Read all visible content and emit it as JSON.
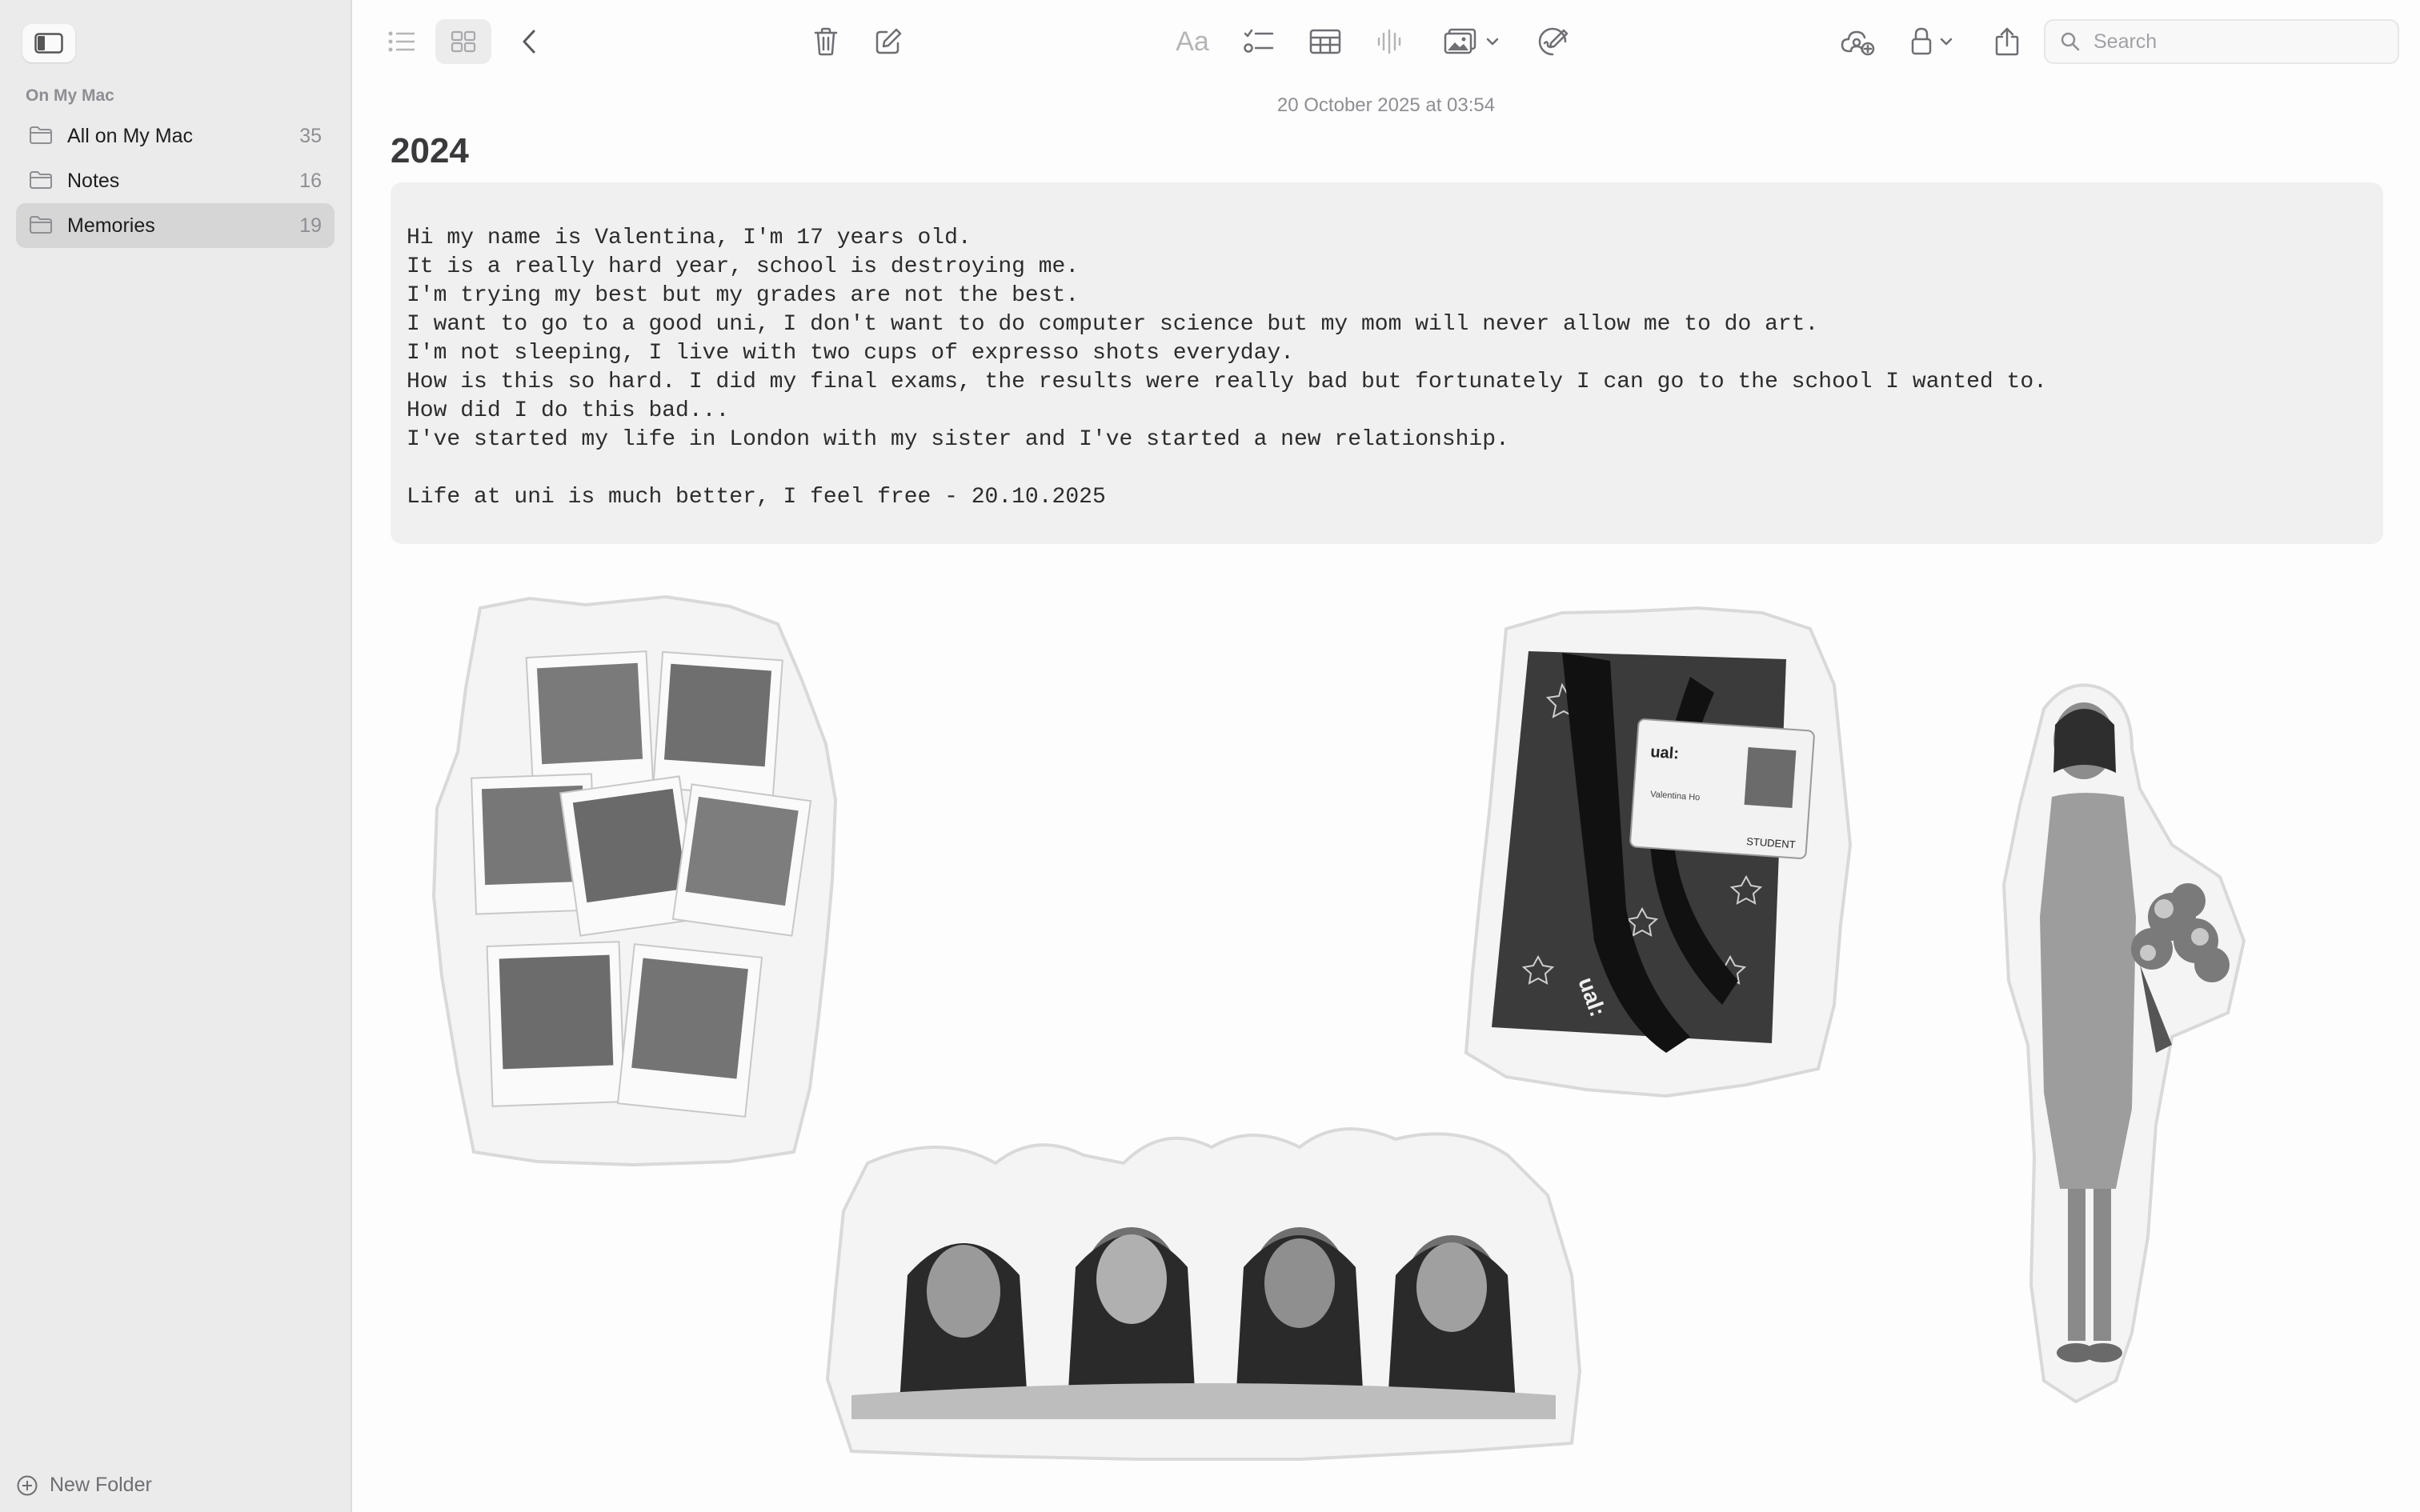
{
  "sidebar": {
    "section_title": "On My Mac",
    "folders": [
      {
        "label": "All on My Mac",
        "count": "35",
        "selected": false
      },
      {
        "label": "Notes",
        "count": "16",
        "selected": false
      },
      {
        "label": "Memories",
        "count": "19",
        "selected": true
      }
    ],
    "new_folder_label": "New Folder"
  },
  "toolbar": {
    "search_placeholder": "Search",
    "icons": [
      "sidebar-toggle-icon",
      "list-view-icon",
      "gallery-view-icon",
      "back-chevron-icon",
      "trash-icon",
      "compose-icon",
      "format-text-icon",
      "checklist-icon",
      "table-icon",
      "audio-waveform-icon",
      "media-icon",
      "markup-icon",
      "collaborate-icon",
      "lock-icon",
      "share-icon",
      "search-icon"
    ],
    "format_label": "Aa"
  },
  "note": {
    "date": "20 October 2025 at 03:54",
    "title": "2024",
    "code_lines": [
      "Hi my name is Valentina, I'm 17 years old.",
      "It is a really hard year, school is destroying me.",
      "I'm trying my best but my grades are not the best.",
      "I want to go to a good uni, I don't want to do computer science but my mom will never allow me to do art.",
      "I'm not sleeping, I live with two cups of expresso shots everyday.",
      "How is this so hard. I did my final exams, the results were really bad but fortunately I can go to the school I wanted to.",
      "How did I do this bad...",
      "I've started my life in London with my sister and I've started a new relationship.",
      "",
      "Life at uni is much better, I feel free - 20.10.2025"
    ],
    "stickers": {
      "id_card_school": "ual:",
      "id_card_name": "Valentina Ho",
      "id_card_role": "STUDENT",
      "lanyard_text": "ual:"
    }
  },
  "colors": {
    "sidebar_bg": "#ebebeb",
    "selected_bg": "#d6d6d6",
    "icon_gray": "#6e6e73",
    "code_bg": "#f0f0f0"
  }
}
